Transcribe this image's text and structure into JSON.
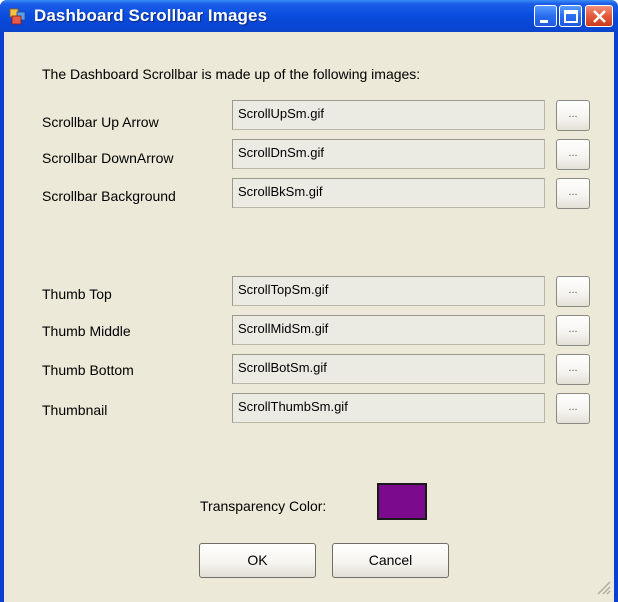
{
  "window": {
    "title": "Dashboard Scrollbar Images",
    "controls": [
      "minimize",
      "maximize",
      "close"
    ]
  },
  "caption": "The Dashboard Scrollbar is made up of the following images:",
  "scrollbar_rows": [
    {
      "label": "Scrollbar Up Arrow",
      "value": "ScrollUpSm.gif",
      "browse": "..."
    },
    {
      "label": "Scrollbar DownArrow",
      "value": "ScrollDnSm.gif",
      "browse": "..."
    },
    {
      "label": "Scrollbar Background",
      "value": "ScrollBkSm.gif",
      "browse": "..."
    }
  ],
  "thumb_rows": [
    {
      "label": "Thumb Top",
      "value": "ScrollTopSm.gif",
      "browse": "..."
    },
    {
      "label": "Thumb Middle",
      "value": "ScrollMidSm.gif",
      "browse": "..."
    },
    {
      "label": "Thumb Bottom",
      "value": "ScrollBotSm.gif",
      "browse": "..."
    },
    {
      "label": "Thumbnail",
      "value": "ScrollThumbSm.gif",
      "browse": "..."
    }
  ],
  "transparency": {
    "label": "Transparency Color:",
    "color": "#7b0a8c"
  },
  "buttons": {
    "ok": "OK",
    "cancel": "Cancel"
  }
}
